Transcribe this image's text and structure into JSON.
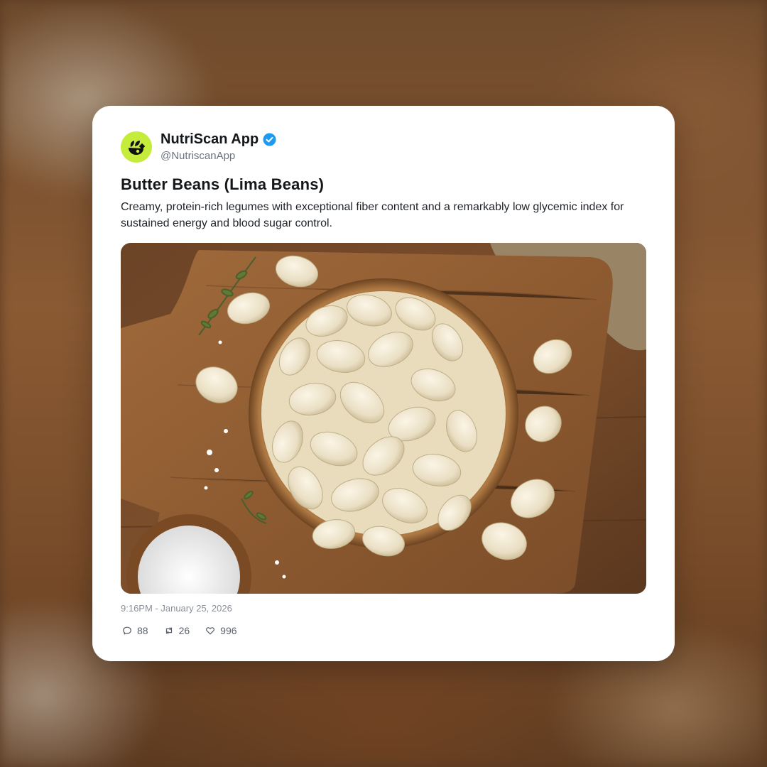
{
  "account": {
    "name": "NutriScan App",
    "handle": "@NutriscanApp",
    "verified": true,
    "avatar_color": "#c6ec3b",
    "avatar_icon": "leaf-logo-icon"
  },
  "post": {
    "title": "Butter Beans (Lima Beans)",
    "description": "Creamy, protein-rich legumes with exceptional fiber content and a remarkably low glycemic index for sustained energy and blood sugar control.",
    "image_alt": "Wooden bowl of butter beans on a rustic cutting board with thyme and coarse salt",
    "timestamp": "9:16PM - January 25, 2026"
  },
  "stats": {
    "replies": "88",
    "reposts": "26",
    "likes": "996"
  },
  "colors": {
    "verified_badge": "#1d9bf0",
    "card_bg": "#ffffff"
  }
}
